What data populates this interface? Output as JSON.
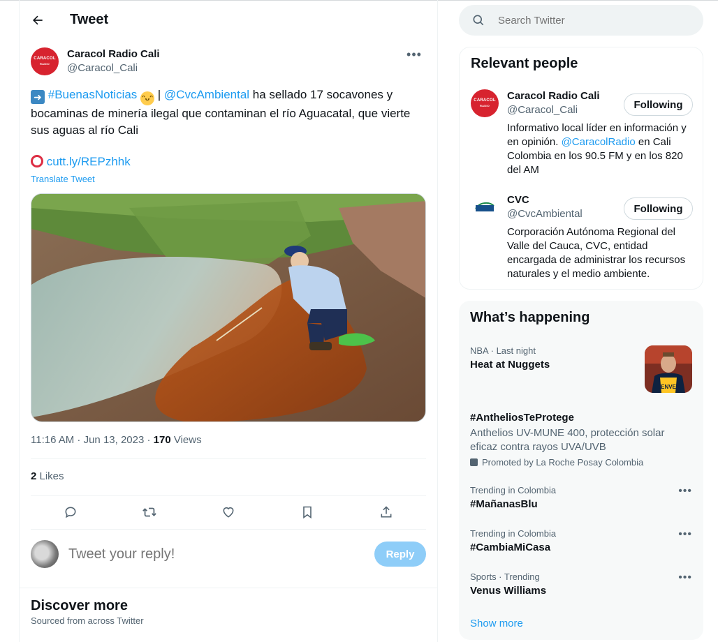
{
  "header": {
    "title": "Tweet"
  },
  "tweet": {
    "author_name": "Caracol Radio Cali",
    "author_handle": "@Caracol_Cali",
    "avatar_text": "CARACOL",
    "avatar_subtext": "RADIO",
    "hashtag": "#BuenasNoticias",
    "separator": " | ",
    "mention": "@CvcAmbiental",
    "body": " ha sellado 17 socavones y bocaminas de minería ilegal que contaminan el río Aguacatal, que vierte sus aguas al río Cali",
    "link": "cutt.ly/REPzhhk",
    "translate": "Translate Tweet",
    "time": "11:16 AM · Jun 13, 2023 · ",
    "views_count": "170",
    "views_label": " Views",
    "likes_count": "2",
    "likes_label": " Likes"
  },
  "reply": {
    "placeholder": "Tweet your reply!",
    "button": "Reply"
  },
  "discover": {
    "title": "Discover more",
    "subtitle": "Sourced from across Twitter"
  },
  "search": {
    "placeholder": "Search Twitter"
  },
  "relevant_people": {
    "title": "Relevant people",
    "people": [
      {
        "name": "Caracol Radio Cali",
        "handle": "@Caracol_Cali",
        "bio_pre": "Informativo local líder en información y en opinión. ",
        "bio_mention": "@CaracolRadio",
        "bio_post": " en Cali Colombia en los 90.5 FM y en los 820 del AM",
        "button": "Following"
      },
      {
        "name": "CVC",
        "handle": "@CvcAmbiental",
        "logo_text": "CVC",
        "bio_pre": "Corporación Autónoma Regional del Valle del Cauca, CVC, entidad encargada de administrar los recursos naturales y el medio ambiente.",
        "bio_mention": "",
        "bio_post": "",
        "button": "Following"
      }
    ]
  },
  "happening": {
    "title": "What’s happening",
    "trends": [
      {
        "context": "NBA · Last night",
        "name": "Heat at Nuggets",
        "thumb_text": "DENVER"
      },
      {
        "context": "",
        "name": "#AntheliosTeProtege",
        "desc": "Anthelios UV-MUNE 400, protección solar eficaz contra rayos UVA/UVB",
        "promo": "Promoted by La Roche Posay Colombia"
      },
      {
        "context": "Trending in Colombia",
        "name": "#MañanasBlu"
      },
      {
        "context": "Trending in Colombia",
        "name": "#CambiaMiCasa"
      },
      {
        "context": "Sports · Trending",
        "name": "Venus Williams"
      }
    ],
    "show_more": "Show more"
  },
  "colors": {
    "accent": "#1d9bf0",
    "brand_red": "#d7232f",
    "reply_button": "#8ecdf8"
  }
}
